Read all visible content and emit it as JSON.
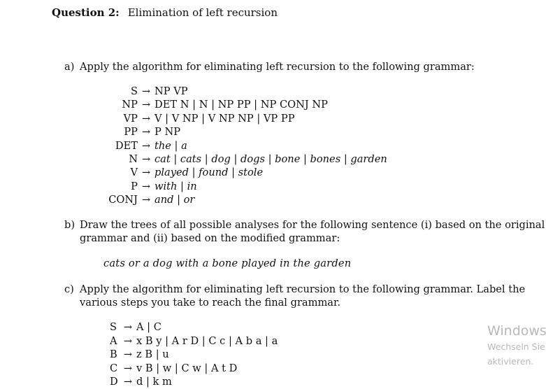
{
  "question": {
    "number_label": "Question 2:",
    "title": "Elimination of left recursion"
  },
  "part_a": {
    "label": "a)",
    "text": "Apply the algorithm for eliminating left recursion to the following grammar:",
    "grammar": [
      {
        "lhs": "S",
        "arrow": "→",
        "rhs": "NP VP",
        "italic": false
      },
      {
        "lhs": "NP",
        "arrow": "→",
        "rhs": "DET N | N | NP PP | NP CONJ NP",
        "italic": false
      },
      {
        "lhs": "VP",
        "arrow": "→",
        "rhs": "V | V NP | V NP NP | VP PP",
        "italic": false
      },
      {
        "lhs": "PP",
        "arrow": "→",
        "rhs": "P NP",
        "italic": false
      },
      {
        "lhs": "DET",
        "arrow": "→",
        "rhs": "the | a",
        "italic": true
      },
      {
        "lhs": "N",
        "arrow": "→",
        "rhs": "cat | cats | dog | dogs | bone | bones | garden",
        "italic": true
      },
      {
        "lhs": "V",
        "arrow": "→",
        "rhs": "played | found | stole",
        "italic": true
      },
      {
        "lhs": "P",
        "arrow": "→",
        "rhs": "with | in",
        "italic": true
      },
      {
        "lhs": "CONJ",
        "arrow": "→",
        "rhs": "and | or",
        "italic": true
      }
    ]
  },
  "part_b": {
    "label": "b)",
    "text_line1": "Draw the trees of all possible analyses for the following sentence (i) based on the original",
    "text_line2": "grammar and (ii) based on the modified grammar:",
    "sentence": "cats or a dog with a bone played in the garden"
  },
  "part_c": {
    "label": "c)",
    "text_line1": "Apply the algorithm for eliminating left recursion to the following grammar. Label the",
    "text_line2": "various steps you take to reach the final grammar.",
    "grammar": [
      {
        "lhs": "S",
        "arrow": "→",
        "rhs": "A | C"
      },
      {
        "lhs": "A",
        "arrow": "→",
        "rhs": "x B y | A r D | C c | A b a | a"
      },
      {
        "lhs": "B",
        "arrow": "→",
        "rhs": "z B | u"
      },
      {
        "lhs": "C",
        "arrow": "→",
        "rhs": "v B | w | C w | A t D"
      },
      {
        "lhs": "D",
        "arrow": "→",
        "rhs": "d | k m"
      }
    ]
  },
  "watermark": {
    "line1": "Windows",
    "line2": "Wechseln Sie",
    "line3": "aktivieren."
  }
}
